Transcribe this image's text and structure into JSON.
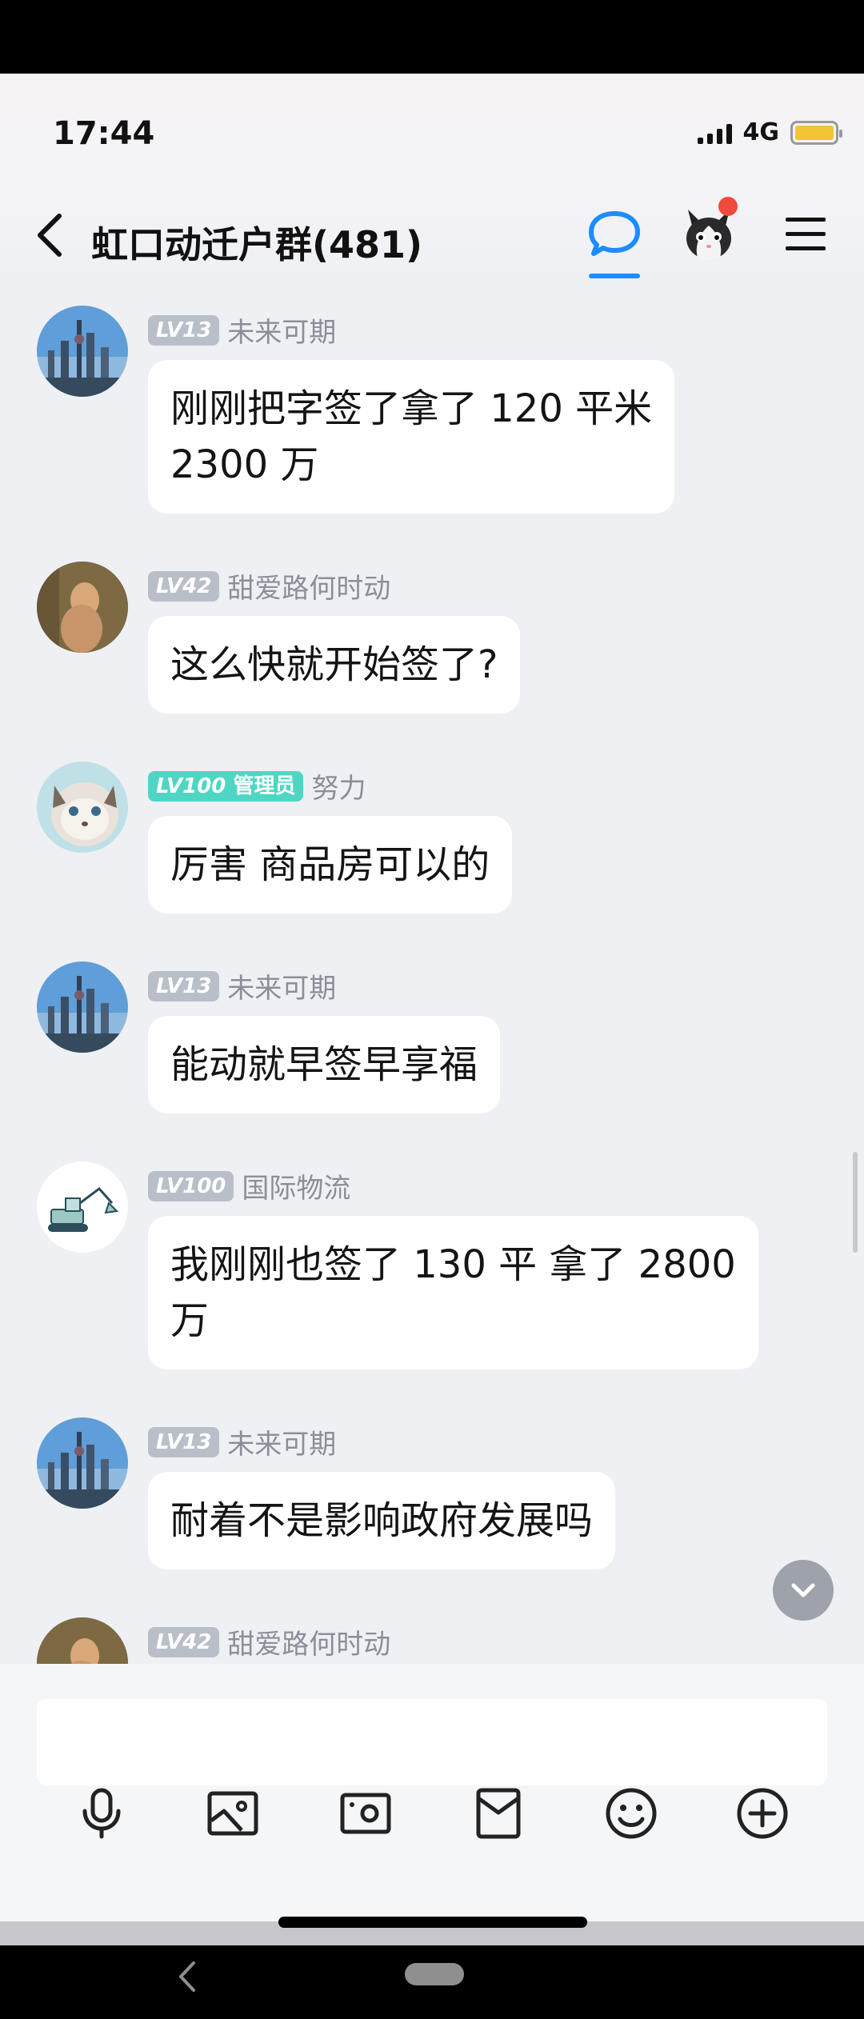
{
  "status_bar": {
    "time": "17:44",
    "network": "4G"
  },
  "header": {
    "title": "虹口动迁户群(481)"
  },
  "messages": [
    {
      "level": "LV13",
      "role": "",
      "nick": "未来可期",
      "avatar": "shanghai-skyline",
      "lines": [
        "刚刚把字签了拿了 120 平米",
        "2300 万"
      ]
    },
    {
      "level": "LV42",
      "role": "",
      "nick": "甜爱路何时动",
      "avatar": "toy-figure",
      "lines": [
        "这么快就开始签了?"
      ]
    },
    {
      "level": "LV100",
      "role": "管理员",
      "nick": "努力",
      "avatar": "cat",
      "lines": [
        "厉害 商品房可以的"
      ]
    },
    {
      "level": "LV13",
      "role": "",
      "nick": "未来可期",
      "avatar": "shanghai-skyline",
      "lines": [
        "能动就早签早享福"
      ]
    },
    {
      "level": "LV100",
      "role": "",
      "nick": "国际物流",
      "avatar": "excavator",
      "lines": [
        "我刚刚也签了 130 平 拿了 2800",
        "万"
      ]
    },
    {
      "level": "LV13",
      "role": "",
      "nick": "未来可期",
      "avatar": "shanghai-skyline",
      "lines": [
        "耐着不是影响政府发展吗"
      ]
    },
    {
      "level": "LV42",
      "role": "",
      "nick": "甜爱路何时动",
      "avatar": "toy-figure",
      "lines": []
    }
  ],
  "input": {
    "value": "",
    "placeholder": ""
  },
  "toolbar": [
    "microphone-icon",
    "image-icon",
    "camera-icon",
    "red-packet-icon",
    "emoji-icon",
    "plus-icon"
  ],
  "colors": {
    "accent": "#1e8cff",
    "admin_badge": "#4fd6c3",
    "level_badge": "#b9bfc9",
    "notification": "#f04a3c"
  }
}
